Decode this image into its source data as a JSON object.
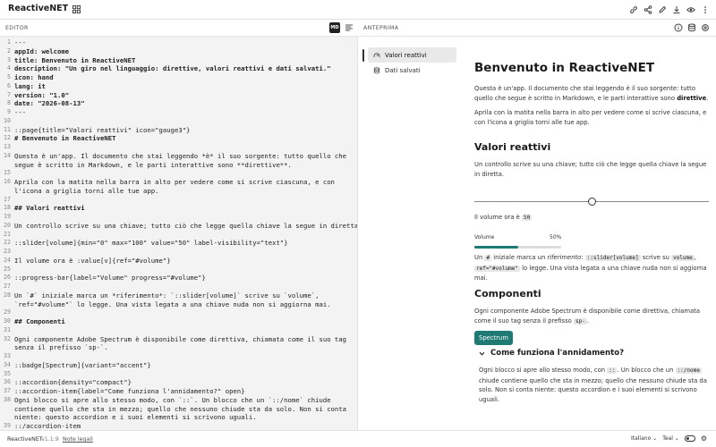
{
  "app": {
    "name": "ReactiveNET"
  },
  "editor": {
    "title": "EDITOR",
    "md_label": "MD",
    "lines": [
      {
        "n": "1",
        "t": "---"
      },
      {
        "n": "2",
        "t": "appId: welcome",
        "b": true
      },
      {
        "n": "3",
        "t": "title: Benvenuto in ReactiveNET",
        "b": true
      },
      {
        "n": "4",
        "t": "description: \"Un giro nel linguaggio: direttive, valori reattivi e dati salvati.\"",
        "b": true
      },
      {
        "n": "5",
        "t": "icon: hand",
        "b": true
      },
      {
        "n": "6",
        "t": "lang: it",
        "b": true
      },
      {
        "n": "7",
        "t": "version: \"1.0\"",
        "b": true
      },
      {
        "n": "8",
        "t": "date: \"2026-08-13\"",
        "b": true
      },
      {
        "n": "9",
        "t": "---"
      },
      {
        "n": "10",
        "t": ""
      },
      {
        "n": "11",
        "t": "::page{title=\"Valori reattivi\" icon=\"gauge3\"}"
      },
      {
        "n": "12",
        "t": "# Benvenuto in ReactiveNET",
        "b": true
      },
      {
        "n": "13",
        "t": ""
      },
      {
        "n": "14",
        "t": "Questa è un'app. Il documento che stai leggendo *è* il suo sorgente: tutto quello che"
      },
      {
        "n": "",
        "t": "segue è scritto in Markdown, e le parti interattive sono **direttive**."
      },
      {
        "n": "15",
        "t": ""
      },
      {
        "n": "16",
        "t": "Aprila con la matita nella barra in alto per vedere come si scrive ciascuna, e con"
      },
      {
        "n": "",
        "t": "l'icona a griglia torni alle tue app."
      },
      {
        "n": "17",
        "t": ""
      },
      {
        "n": "18",
        "t": "## Valori reattivi",
        "b": true
      },
      {
        "n": "19",
        "t": ""
      },
      {
        "n": "20",
        "t": "Un controllo scrive su una chiave; tutto ciò che legge quella chiave la segue in diretta."
      },
      {
        "n": "21",
        "t": ""
      },
      {
        "n": "22",
        "t": "::slider[volume]{min=\"0\" max=\"100\" value=\"50\" label-visibility=\"text\"}"
      },
      {
        "n": "23",
        "t": ""
      },
      {
        "n": "24",
        "t": "Il volume ora è :value[v]{ref=\"#volume\"}"
      },
      {
        "n": "25",
        "t": ""
      },
      {
        "n": "26",
        "t": "::progress-bar{label=\"Volume\" progress=\"#volume\"}"
      },
      {
        "n": "27",
        "t": ""
      },
      {
        "n": "28",
        "t": "Un `#` iniziale marca un *riferimento*: `::slider[volume]` scrive su `volume`,"
      },
      {
        "n": "",
        "t": "`ref=\"#volume\"` lo legge. Una vista legata a una chiave nuda non si aggiorna mai."
      },
      {
        "n": "29",
        "t": ""
      },
      {
        "n": "30",
        "t": "## Componenti",
        "b": true
      },
      {
        "n": "31",
        "t": ""
      },
      {
        "n": "32",
        "t": "Ogni componente Adobe Spectrum è disponibile come direttiva, chiamata come il suo tag"
      },
      {
        "n": "",
        "t": "senza il prefisso `sp-`."
      },
      {
        "n": "33",
        "t": ""
      },
      {
        "n": "34",
        "t": "::badge[Spectrum]{variant=\"accent\"}"
      },
      {
        "n": "35",
        "t": ""
      },
      {
        "n": "36",
        "t": "::accordion{density=\"compact\"}"
      },
      {
        "n": "37",
        "t": "::accordion-item{label=\"Come funziona l'annidamento?\" open}"
      },
      {
        "n": "38",
        "t": "Ogni blocco si apre allo stesso modo, con `::`. Un blocco che un `::/nome` chiude"
      },
      {
        "n": "",
        "t": "contiene quello che sta in mezzo; quello che nessuno chiude sta da solo. Non si conta"
      },
      {
        "n": "",
        "t": "niente: questo accordion e i suoi elementi si scrivono uguali."
      },
      {
        "n": "39",
        "t": "::/accordion-item"
      }
    ]
  },
  "preview": {
    "title": "ANTEPRIMA",
    "nav": [
      {
        "label": "Valori reattivi",
        "icon": "gauge-icon",
        "active": true
      },
      {
        "label": "Dati salvati",
        "icon": "database-icon",
        "active": false
      }
    ],
    "h1": "Benvenuto in ReactiveNET",
    "p1a": "Questa è un'app. Il documento che stai leggendo è il suo sorgente: tutto quello che segue è scritto in Markdown, e le parti interattive sono ",
    "p1b": "direttive",
    "p1c": ".",
    "p2": "Aprila con la matita nella barra in alto per vedere come si scrive ciascuna, e con l'icona a griglia torni alle tue app.",
    "h2a": "Valori reattivi",
    "p3": "Un controllo scrive su una chiave; tutto ciò che legge quella chiave la segue in diretta.",
    "slider_value": 0.5,
    "volume_text": "Il volume ora è",
    "volume_value": "50",
    "pb_label": "Volume",
    "pb_value": "50%",
    "pb_fraction": 0.5,
    "p4": {
      "a": "Un ",
      "c1": "#",
      "b": " iniziale marca un ",
      "i": "riferimento",
      "c": ": ",
      "c2": "::slider[volume]",
      "d": " scrive su ",
      "c3": "volume",
      "e": ",",
      "c4": "ref=\"#volume\"",
      "f": " lo legge. Una vista legata a una chiave nuda non si aggiorna mai."
    },
    "h2b": "Componenti",
    "p5a": "Ogni componente Adobe Spectrum è disponibile come direttiva, chiamata come il suo tag senza il prefisso ",
    "p5chip": "sp-",
    "p5b": ".",
    "badge": "Spectrum",
    "accordion_label": "Come funziona l'annidamento?",
    "acc": {
      "a": "Ogni blocco si apre allo stesso modo, con ",
      "c1": "::",
      "b": ". Un blocco che un ",
      "c2": "::/nome",
      "c": " chiude contiene quello che sta in mezzo; quello che nessuno chiude sta da solo. Non si conta niente: questo accordion e i suoi elementi si scrivono uguali."
    }
  },
  "status": {
    "app": "ReactiveNET",
    "version": "v1.1.9",
    "legal": "Note legali",
    "lang": "Italiano",
    "theme": "Teal"
  },
  "colors": {
    "accent": "#1f7a74"
  }
}
